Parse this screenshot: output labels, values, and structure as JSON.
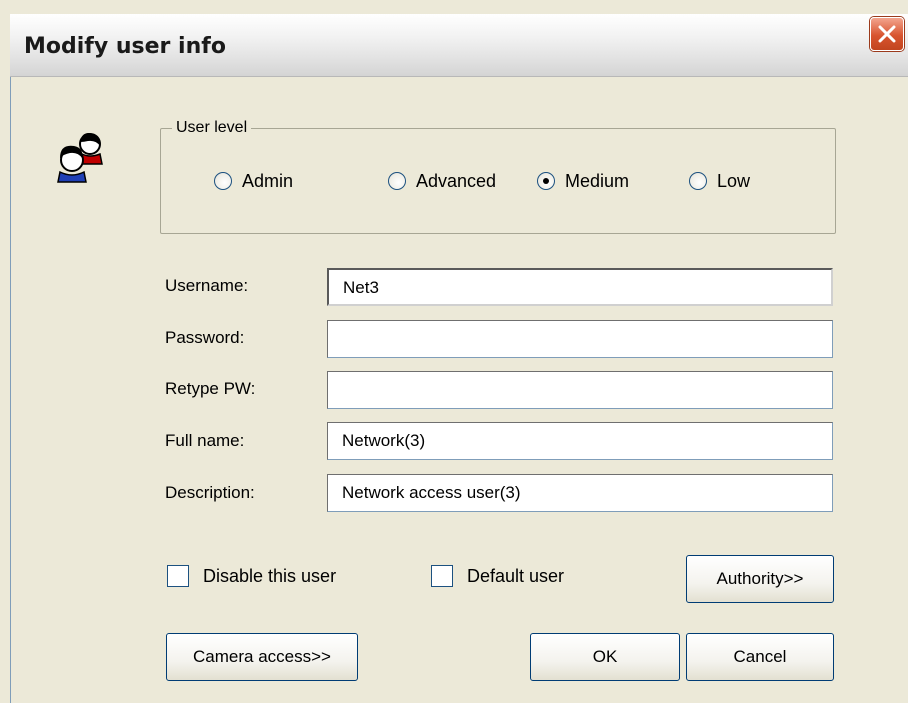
{
  "window": {
    "title": "Modify user info"
  },
  "user_level": {
    "label": "User level",
    "options": [
      {
        "label": "Admin",
        "checked": false
      },
      {
        "label": "Advanced",
        "checked": false
      },
      {
        "label": "Medium",
        "checked": true
      },
      {
        "label": "Low",
        "checked": false
      }
    ]
  },
  "fields": {
    "username": {
      "label": "Username:",
      "value": "Net3"
    },
    "password": {
      "label": "Password:",
      "value": ""
    },
    "retype": {
      "label": "Retype PW:",
      "value": ""
    },
    "fullname": {
      "label": "Full name:",
      "value": "Network(3)"
    },
    "description": {
      "label": "Description:",
      "value": "Network access user(3)"
    }
  },
  "checkboxes": {
    "disable": {
      "label": "Disable this user",
      "checked": false
    },
    "default": {
      "label": "Default user",
      "checked": false
    }
  },
  "buttons": {
    "authority": "Authority>>",
    "camera_access": "Camera access>>",
    "ok": "OK",
    "cancel": "Cancel"
  },
  "icons": {
    "close": "close-icon",
    "users": "users-icon"
  }
}
